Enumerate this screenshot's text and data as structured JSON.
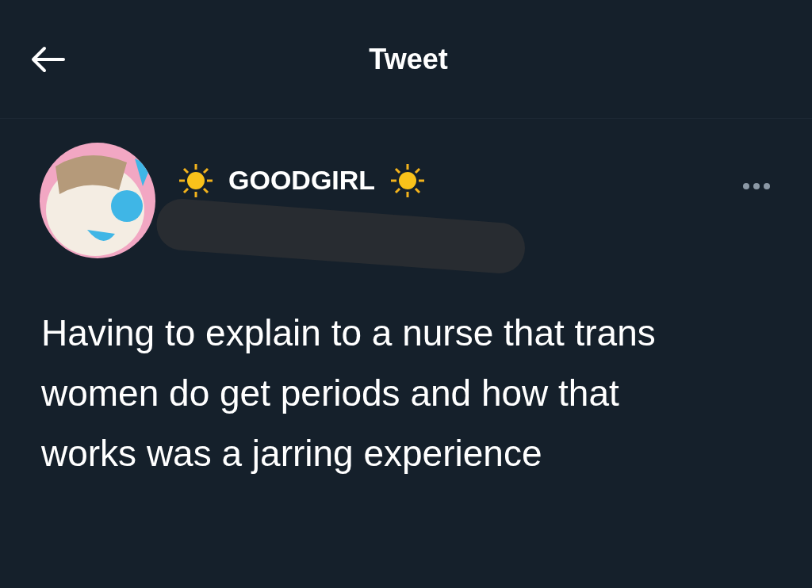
{
  "header": {
    "title": "Tweet"
  },
  "author": {
    "display_name": "GOODGIRL"
  },
  "tweet": {
    "text": "Having to explain to a nurse that trans women do get periods and how that works was a jarring experience"
  }
}
